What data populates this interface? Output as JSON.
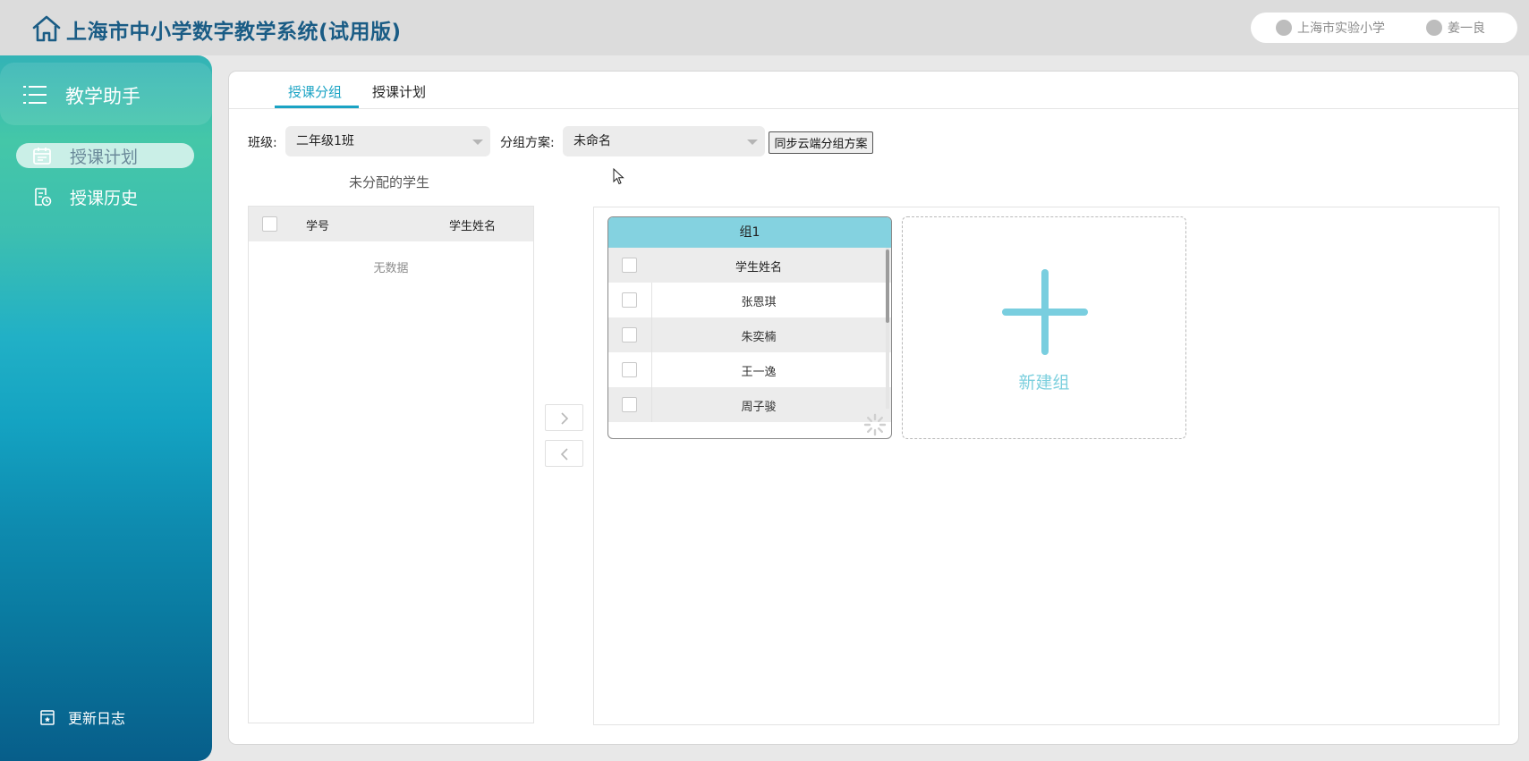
{
  "header": {
    "title": "上海市中小学数字教学系统(试用版)",
    "school": "上海市实验小学",
    "user": "姜一良"
  },
  "sidebar": {
    "title": "教学助手",
    "items": [
      {
        "label": "授课计划",
        "icon": "calendar-icon",
        "active": true
      },
      {
        "label": "授课历史",
        "icon": "document-clock-icon",
        "active": false
      }
    ],
    "footer": "更新日志"
  },
  "tabs": [
    {
      "label": "授课分组",
      "active": true
    },
    {
      "label": "授课计划",
      "active": false
    }
  ],
  "filters": {
    "class_label": "班级:",
    "class_value": "二年级1班",
    "plan_label": "分组方案:",
    "plan_value": "未命名",
    "sync_button": "同步云端分组方案"
  },
  "unassigned": {
    "title": "未分配的学生",
    "columns": [
      "学号",
      "学生姓名"
    ],
    "empty_text": "无数据"
  },
  "groups": [
    {
      "title": "组1",
      "column": "学生姓名",
      "students": [
        "张恩琪",
        "朱奕楠",
        "王一逸",
        "周子骏"
      ]
    }
  ],
  "new_group": {
    "label": "新建组"
  },
  "colors": {
    "accent": "#1aa3c4",
    "group_header": "#84d2e0",
    "title_blue": "#1a5c85"
  }
}
